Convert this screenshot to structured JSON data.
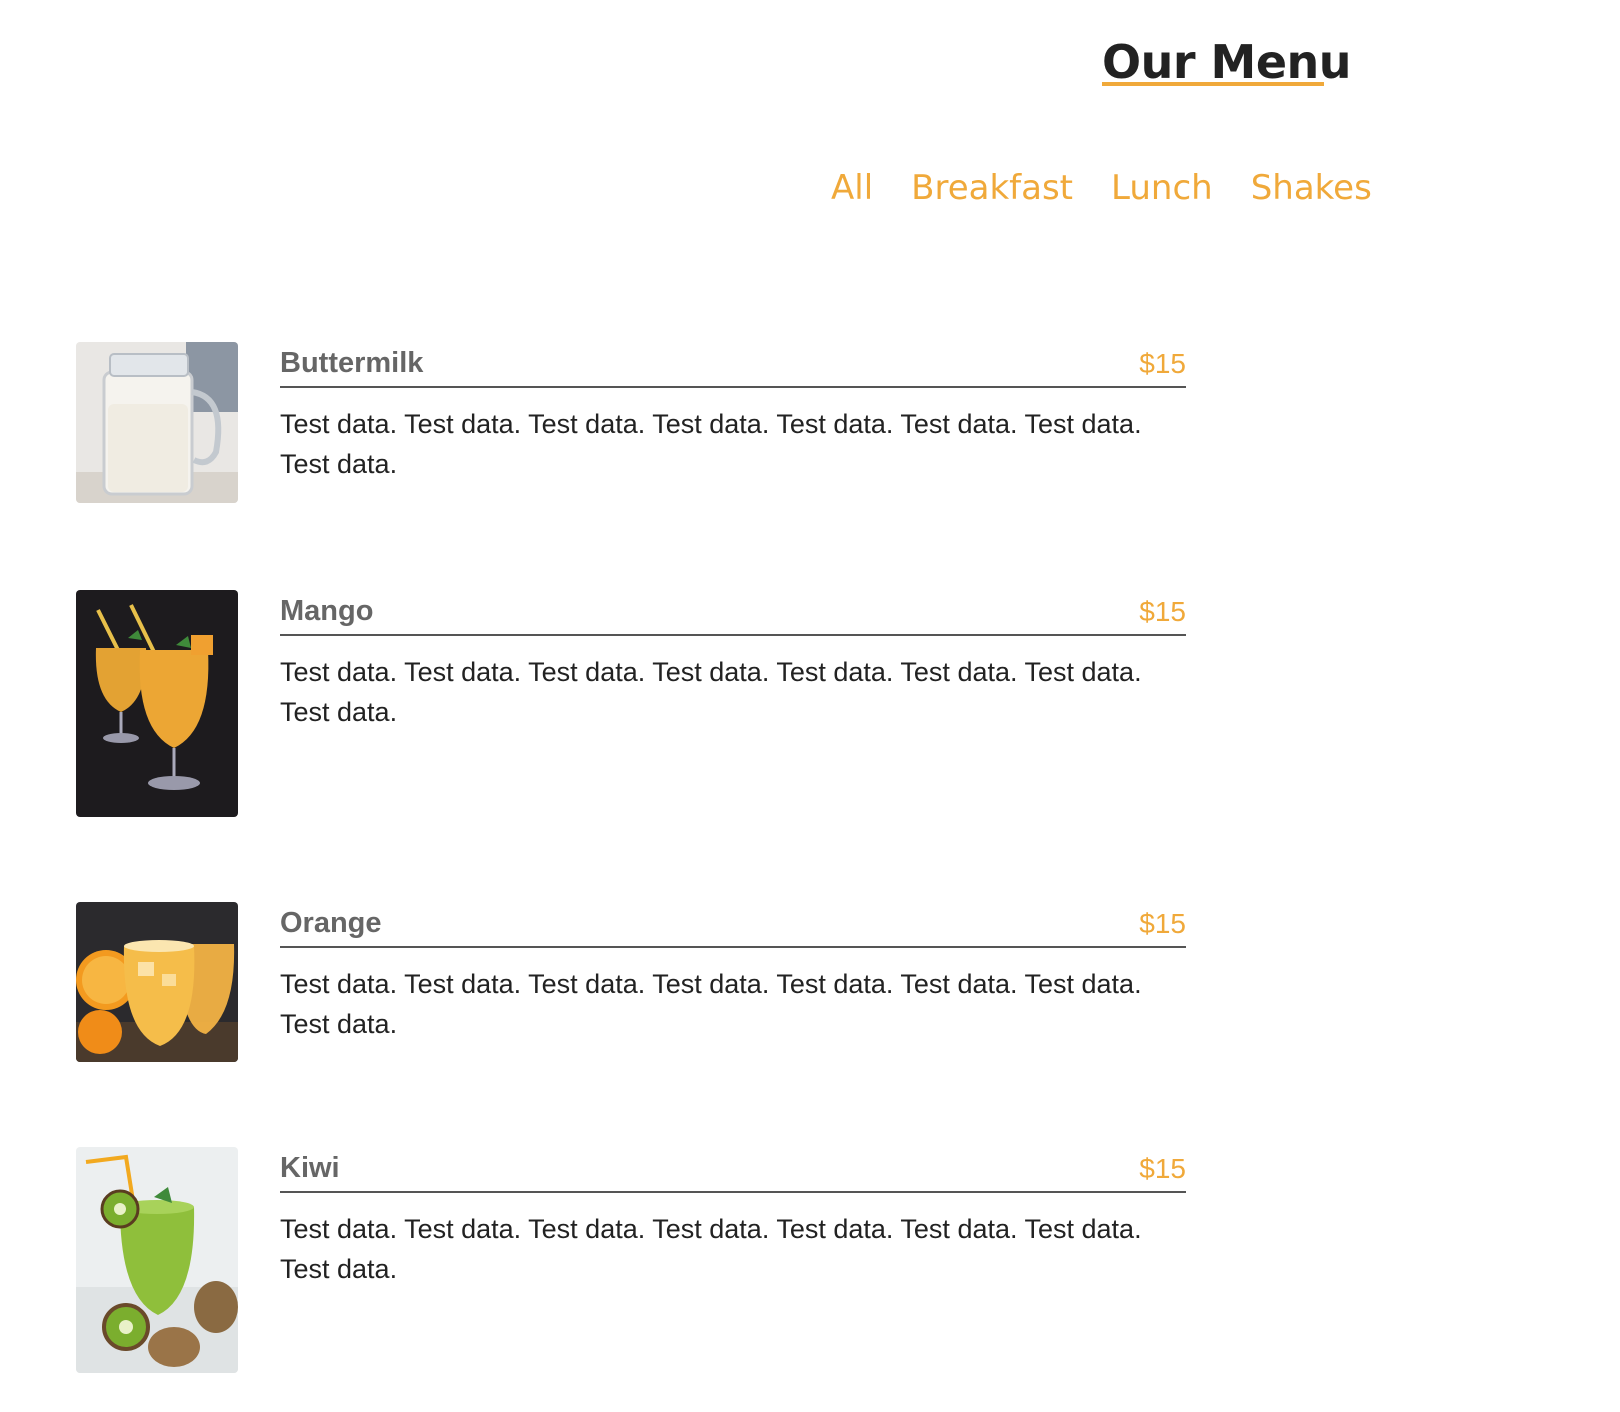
{
  "header": {
    "title": "Our Menu"
  },
  "filters": [
    "All",
    "Breakfast",
    "Lunch",
    "Shakes"
  ],
  "items": [
    {
      "name": "Buttermilk",
      "price": "$15",
      "description": "Test data. Test data. Test data. Test data. Test data. Test data. Test data. Test data.",
      "image": "buttermilk-jar"
    },
    {
      "name": "Mango",
      "price": "$15",
      "description": "Test data. Test data. Test data. Test data. Test data. Test data. Test data. Test data.",
      "image": "mango-smoothie-glasses"
    },
    {
      "name": "Orange",
      "price": "$15",
      "description": "Test data. Test data. Test data. Test data. Test data. Test data. Test data. Test data.",
      "image": "orange-juice-glasses"
    },
    {
      "name": "Kiwi",
      "price": "$15",
      "description": "Test data. Test data. Test data. Test data. Test data. Test data. Test data. Test data.",
      "image": "kiwi-smoothie-glass"
    }
  ],
  "colors": {
    "accent": "#f0a93a",
    "text": "#222222",
    "item_name": "#666666"
  }
}
